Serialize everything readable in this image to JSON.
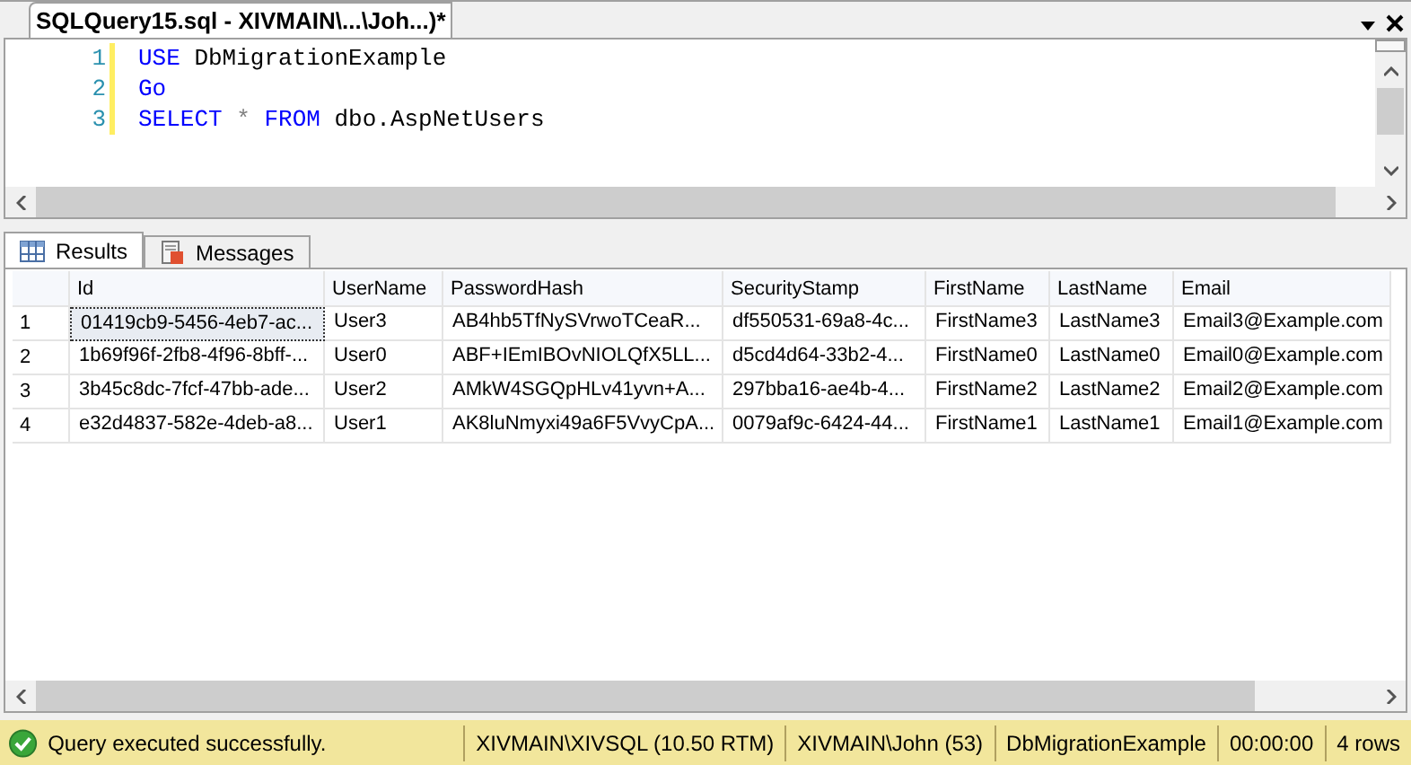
{
  "document_tab": {
    "title": "SQLQuery15.sql - XIVMAIN\\...\\Joh...)*",
    "modified": true
  },
  "editor": {
    "lines": [
      {
        "number": "1",
        "tokens": [
          {
            "kind": "keyword",
            "text": "USE"
          },
          {
            "kind": "plain",
            "text": "DbMigrationExample"
          }
        ]
      },
      {
        "number": "2",
        "tokens": [
          {
            "kind": "keyword",
            "text": "Go"
          }
        ]
      },
      {
        "number": "3",
        "tokens": [
          {
            "kind": "keyword",
            "text": "SELECT"
          },
          {
            "kind": "operator",
            "text": "*"
          },
          {
            "kind": "keyword",
            "text": "FROM"
          },
          {
            "kind": "plain",
            "text": "dbo.AspNetUsers"
          }
        ]
      }
    ]
  },
  "result_tabs": [
    {
      "label": "Results",
      "kind": "grid",
      "selected": true
    },
    {
      "label": "Messages",
      "kind": "messages",
      "selected": false
    }
  ],
  "table": {
    "columns": [
      "Id",
      "UserName",
      "PasswordHash",
      "SecurityStamp",
      "FirstName",
      "LastName",
      "Email"
    ],
    "rows": [
      {
        "number": "1",
        "selected": true,
        "cells": [
          "01419cb9-5456-4eb7-ac...",
          "User3",
          "AB4hb5TfNySVrwoTCeaR...",
          "df550531-69a8-4c...",
          "FirstName3",
          "LastName3",
          "Email3@Example.com"
        ]
      },
      {
        "number": "2",
        "selected": false,
        "cells": [
          "1b69f96f-2fb8-4f96-8bff-...",
          "User0",
          "ABF+IEmIBOvNIOLQfX5LL...",
          "d5cd4d64-33b2-4...",
          "FirstName0",
          "LastName0",
          "Email0@Example.com"
        ]
      },
      {
        "number": "3",
        "selected": false,
        "cells": [
          "3b45c8dc-7fcf-47bb-ade...",
          "User2",
          "AMkW4SGQpHLv41yvn+A...",
          "297bba16-ae4b-4...",
          "FirstName2",
          "LastName2",
          "Email2@Example.com"
        ]
      },
      {
        "number": "4",
        "selected": false,
        "cells": [
          "e32d4837-582e-4deb-a8...",
          "User1",
          "AK8luNmyxi49a6F5VvyCpA...",
          "0079af9c-6424-44...",
          "FirstName1",
          "LastName1",
          "Email1@Example.com"
        ]
      }
    ]
  },
  "status_bar": {
    "message": "Query executed successfully.",
    "server": "XIVMAIN\\XIVSQL (10.50 RTM)",
    "user": "XIVMAIN\\John (53)",
    "database": "DbMigrationExample",
    "elapsed": "00:00:00",
    "rows": "4 rows"
  }
}
